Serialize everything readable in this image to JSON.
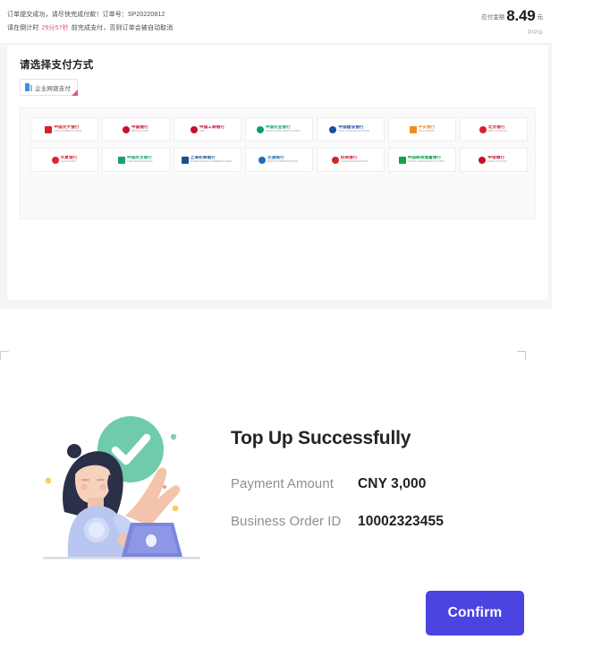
{
  "payment_page": {
    "header": {
      "order_line": "订单提交成功，请尽快完成付款！订单号：SP20220812",
      "countdown_prefix": "请在倒计时 ",
      "countdown_value": "29分57秒",
      "countdown_suffix": " 前完成支付，否则订单会被自动取消",
      "amount_label": "应付金额",
      "amount_value": "8.49",
      "amount_unit": "元",
      "brand": "PIPO"
    },
    "card": {
      "title": "请选择支付方式",
      "tabs": [
        {
          "label": "企业网银支付",
          "icon": "bank-card-icon",
          "selected": true
        }
      ]
    },
    "banks": [
      {
        "cn": "中国光大银行",
        "en": "CHINA EVERBRIGHT BANK",
        "color": "#d5232b",
        "shape": "sq"
      },
      {
        "cn": "中国银行",
        "en": "BANK OF CHINA",
        "color": "#c8102e",
        "shape": "circle"
      },
      {
        "cn": "中国工商银行",
        "en": "ICBC",
        "color": "#c8102e",
        "shape": "circle"
      },
      {
        "cn": "中国农业银行",
        "en": "AGRICULTURAL BANK OF CHINA",
        "color": "#0e9e6e",
        "shape": "circle"
      },
      {
        "cn": "中国建设银行",
        "en": "CHINA CONSTRUCTION BANK",
        "color": "#1a4f9c",
        "shape": "circle"
      },
      {
        "cn": "平安银行",
        "en": "PING AN BANK",
        "color": "#f08c22",
        "shape": "sq"
      },
      {
        "cn": "北京银行",
        "en": "BANK OF BEIJING",
        "color": "#d5232b",
        "shape": "circle"
      },
      {
        "cn": "华夏银行",
        "en": "HUA XIA BANK",
        "color": "#e0243c",
        "shape": "circle"
      },
      {
        "cn": "中国民生银行",
        "en": "CHINA MINSHENG BANK",
        "color": "#1aa06d",
        "shape": "sq"
      },
      {
        "cn": "上海农商银行",
        "en": "SHANGHAI RURAL COMMERCIAL BANK",
        "color": "#1d4f91",
        "shape": "sq"
      },
      {
        "cn": "交通银行",
        "en": "BANK OF COMMUNICATIONS",
        "color": "#1d6fb8",
        "shape": "circle"
      },
      {
        "cn": "招商银行",
        "en": "CHINA MERCHANTS BANK",
        "color": "#d5232b",
        "shape": "circle"
      },
      {
        "cn": "中国邮政储蓄银行",
        "en": "POSTAL SAVINGS BANK OF CHINA",
        "color": "#12a14b",
        "shape": "sq"
      },
      {
        "cn": "中信银行",
        "en": "CHINA CITIC BANK",
        "color": "#c8102e",
        "shape": "circle"
      }
    ]
  },
  "success_dialog": {
    "title": "Top Up Successfully",
    "rows": [
      {
        "label": "Payment Amount",
        "value": "CNY 3,000"
      },
      {
        "label": "Business Order ID",
        "value": "10002323455"
      }
    ],
    "confirm_label": "Confirm",
    "illustration": "person-with-laptop-success-check-illustration"
  },
  "colors": {
    "accent_button": "#4B44E0",
    "success_green": "#6FCBA9",
    "countdown_red": "#E8546B",
    "tab_corner_red": "#E8546B"
  }
}
